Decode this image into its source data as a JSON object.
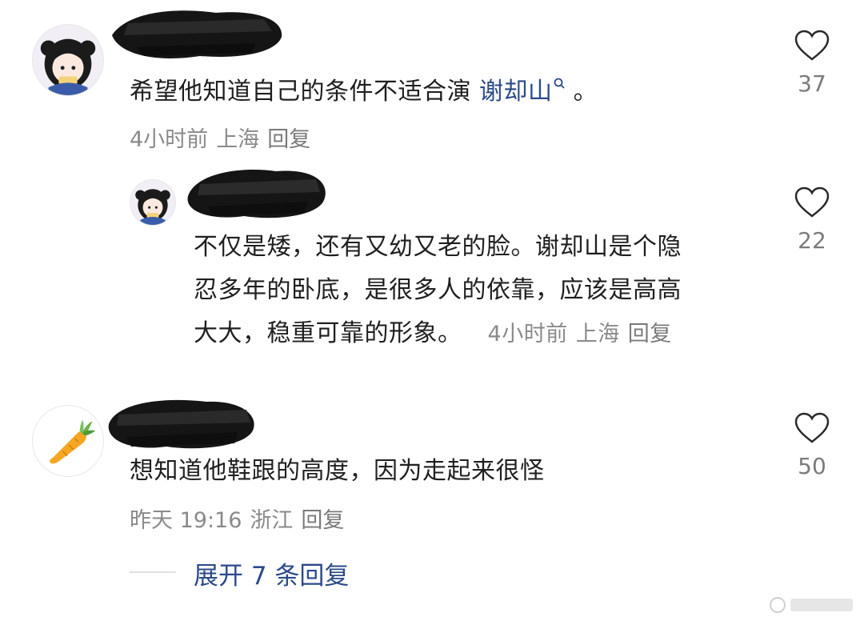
{
  "comments": [
    {
      "text_before_link": "希望他知道自己的条件不适合演 ",
      "link_text": "谢却山",
      "text_after_link": " 。",
      "time": "4小时前",
      "location": "上海",
      "reply_label": "回复",
      "likes": "37",
      "replies": [
        {
          "text": "不仅是矮，还有又幼又老的脸。谢却山是个隐忍多年的卧底，是很多人的依靠，应该是高高大大，稳重可靠的形象。",
          "line1": "不仅是矮，还有又幼又老的脸。谢却山是个隐",
          "line2": "忍多年的卧底，是很多人的依靠，应该是高高",
          "line3": "大大，稳重可靠的形象。",
          "time": "4小时前",
          "location": "上海",
          "reply_label": "回复",
          "likes": "22"
        }
      ]
    },
    {
      "text": "想知道他鞋跟的高度，因为走起来很怪",
      "time": "昨天 19:16",
      "location": "浙江",
      "reply_label": "回复",
      "likes": "50",
      "expand_label": "展开 7 条回复"
    }
  ],
  "colors": {
    "link": "#2b4a8b",
    "meta": "#8a8a8a",
    "text": "#1f1f1f"
  },
  "icons": {
    "like": "heart-outline-icon",
    "search": "search-icon",
    "avatar_anime": "anime-girl-avatar",
    "avatar_carrot": "carrot-avatar"
  }
}
